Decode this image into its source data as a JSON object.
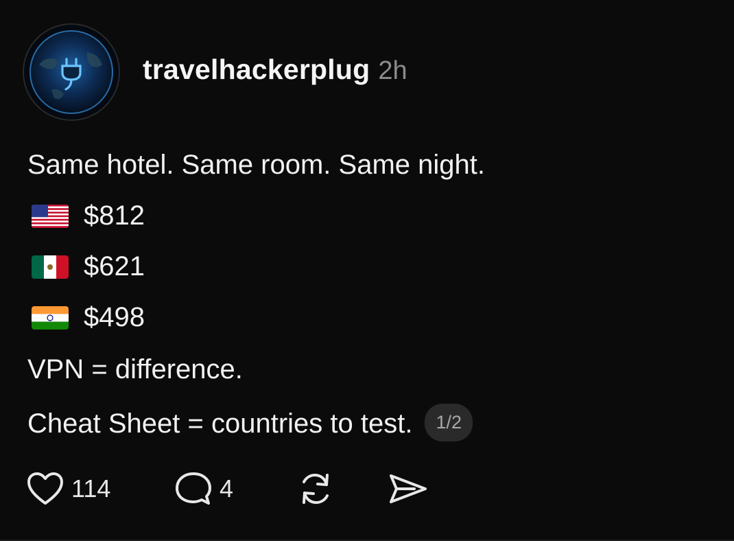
{
  "post": {
    "username": "travelhackerplug",
    "timestamp": "2h",
    "line1": "Same hotel. Same room. Same night.",
    "prices": [
      {
        "flag": "us-flag-icon",
        "price": "$812"
      },
      {
        "flag": "mexico-flag-icon",
        "price": "$621"
      },
      {
        "flag": "india-flag-icon",
        "price": "$498"
      }
    ],
    "line_vpn": "VPN = difference.",
    "line_cheat": "Cheat Sheet = countries to test.",
    "pager": "1/2"
  },
  "actions": {
    "likes": "114",
    "comments": "4"
  },
  "colors": {
    "background": "#0b0b0b",
    "text": "#f2f2f2",
    "muted": "#8c8c8c",
    "pill": "#2a2a2a",
    "avatar_accent": "#3fa9ff"
  }
}
